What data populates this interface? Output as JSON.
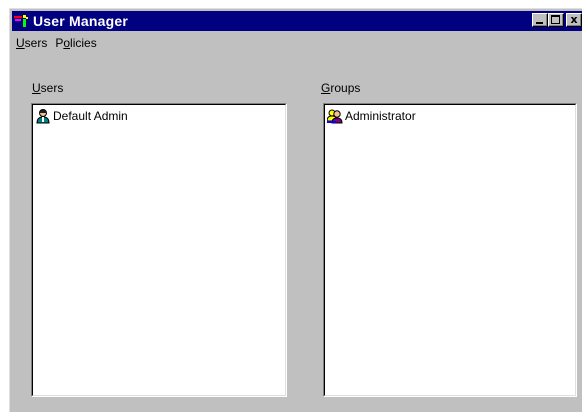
{
  "window": {
    "title": "User Manager",
    "close_glyph": "x"
  },
  "menu": {
    "items": [
      {
        "label_acc": "U",
        "label_rest": "sers"
      },
      {
        "label_pre": "P",
        "label_acc": "o",
        "label_rest": "licies"
      }
    ]
  },
  "users_panel": {
    "label_acc": "U",
    "label_rest": "sers",
    "items": [
      {
        "label": "Default Admin",
        "icon": "user-icon"
      }
    ]
  },
  "groups_panel": {
    "label_acc": "G",
    "label_rest": "roups",
    "items": [
      {
        "label": "Administrator",
        "icon": "group-icon"
      }
    ]
  },
  "colors": {
    "titlebar": "#000080",
    "face": "#c0c0c0",
    "list_bg": "#ffffff"
  }
}
